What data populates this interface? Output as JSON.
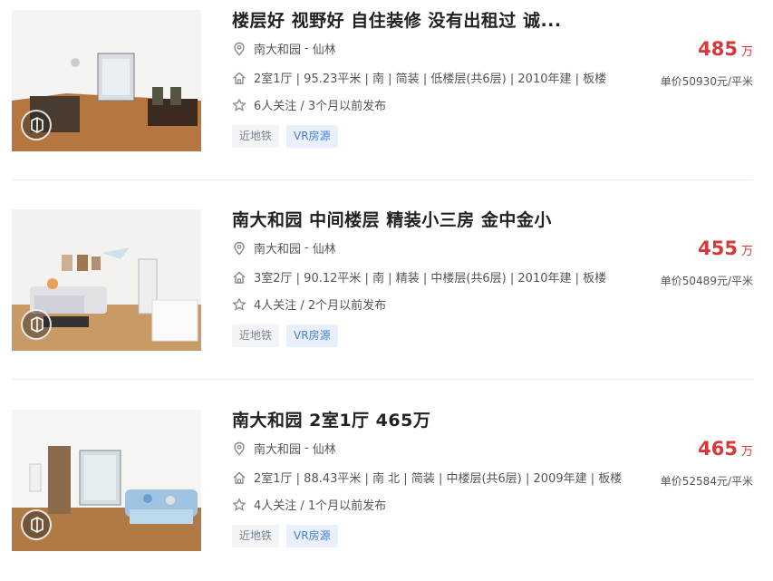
{
  "listings": [
    {
      "title": "楼层好 视野好 自住装修 没有出租过 诚...",
      "community": "南大和园",
      "separator": "-",
      "district": "仙林",
      "attributes": "2室1厅 | 95.23平米 | 南 | 简装 | 低楼层(共6层) | 2010年建 | 板楼",
      "follow": "6人关注 / 3个月以前发布",
      "tags": [
        "近地铁",
        "VR房源"
      ],
      "price": "485",
      "price_unit": "万",
      "unit_price": "单价50930元/平米",
      "icons": {
        "location": "location-pin-icon",
        "house": "house-icon",
        "star": "star-icon",
        "vr": "vr-icon"
      }
    },
    {
      "title": "南大和园 中间楼层 精装小三房 金中金小",
      "community": "南大和园",
      "separator": "-",
      "district": "仙林",
      "attributes": "3室2厅 | 90.12平米 | 南 | 精装 | 中楼层(共6层) | 2010年建 | 板楼",
      "follow": "4人关注 / 2个月以前发布",
      "tags": [
        "近地铁",
        "VR房源"
      ],
      "price": "455",
      "price_unit": "万",
      "unit_price": "单价50489元/平米",
      "icons": {
        "location": "location-pin-icon",
        "house": "house-icon",
        "star": "star-icon",
        "vr": "vr-icon"
      }
    },
    {
      "title": "南大和园 2室1厅 465万",
      "community": "南大和园",
      "separator": "-",
      "district": "仙林",
      "attributes": "2室1厅 | 88.43平米 | 南 北 | 简装 | 中楼层(共6层) | 2009年建 | 板楼",
      "follow": "4人关注 / 1个月以前发布",
      "tags": [
        "近地铁",
        "VR房源"
      ],
      "price": "465",
      "price_unit": "万",
      "unit_price": "单价52584元/平米",
      "icons": {
        "location": "location-pin-icon",
        "house": "house-icon",
        "star": "star-icon",
        "vr": "vr-icon"
      }
    }
  ],
  "colors": {
    "price": "#d6393b",
    "vr_tag": "#4a7ec9",
    "subway_tag": "#7a8490"
  }
}
